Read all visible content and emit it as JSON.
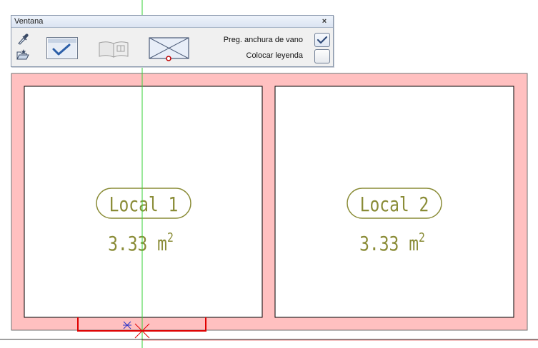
{
  "palette": {
    "title": "Ventana",
    "close_glyph": "×",
    "tools": [
      {
        "name": "eyedropper-icon"
      },
      {
        "name": "open-folder-icon"
      },
      {
        "name": "confirm-check-icon"
      },
      {
        "name": "book-library-icon"
      },
      {
        "name": "window-preview-icon"
      }
    ],
    "options": [
      {
        "label": "Preg. anchura de vano",
        "checked": true
      },
      {
        "label": "Colocar leyenda",
        "checked": false
      }
    ]
  },
  "rooms": [
    {
      "name": "Local 1",
      "area": "3.33 m",
      "area_exp": "2"
    },
    {
      "name": "Local 2",
      "area": "3.33 m",
      "area_exp": "2"
    }
  ],
  "colors": {
    "wall_fill": "#ffc0c0",
    "label_color": "#8a8c37",
    "guide_green": "#36d136",
    "opening_red": "#e00000",
    "cursor_blue": "#2a33c8"
  }
}
